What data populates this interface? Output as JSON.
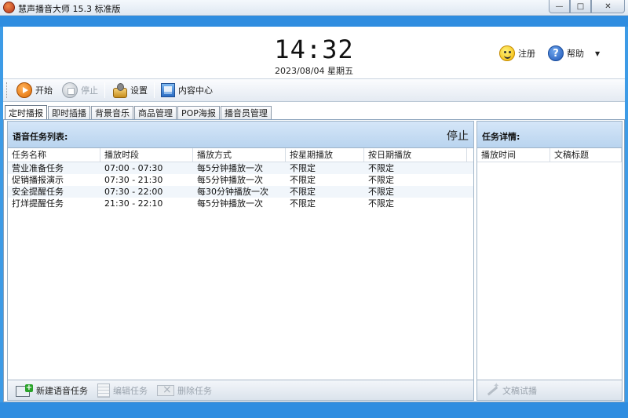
{
  "window": {
    "title": "慧声播音大师 15.3 标准版",
    "buttons": {
      "minimize": "—",
      "maximize": "□",
      "close": "✕"
    }
  },
  "header": {
    "time": "14:32",
    "date": "2023/08/04 星期五",
    "register_label": "注册",
    "help_label": "帮助",
    "dropdown": "▼"
  },
  "toolbar": {
    "start_label": "开始",
    "stop_label": "停止",
    "settings_label": "设置",
    "content_label": "内容中心"
  },
  "tabs": [
    {
      "label": "定时播报",
      "active": true
    },
    {
      "label": "即时插播"
    },
    {
      "label": "背景音乐"
    },
    {
      "label": "商品管理"
    },
    {
      "label": "POP海报"
    },
    {
      "label": "播音员管理"
    }
  ],
  "task_panel": {
    "title": "语音任务列表:",
    "status": "停止",
    "columns": [
      "任务名称",
      "播放时段",
      "播放方式",
      "按星期播放",
      "按日期播放"
    ],
    "rows": [
      [
        "营业准备任务",
        "07:00 - 07:30",
        "每5分钟播放一次",
        "不限定",
        "不限定"
      ],
      [
        "促销播报演示",
        "07:30 - 21:30",
        "每5分钟播放一次",
        "不限定",
        "不限定"
      ],
      [
        "安全提醒任务",
        "07:30 - 22:00",
        "每30分钟播放一次",
        "不限定",
        "不限定"
      ],
      [
        "打烊提醒任务",
        "21:30 - 22:10",
        "每5分钟播放一次",
        "不限定",
        "不限定"
      ]
    ],
    "footer": {
      "new_label": "新建语音任务",
      "edit_label": "编辑任务",
      "delete_label": "删除任务"
    }
  },
  "detail_panel": {
    "title": "任务详情:",
    "columns": [
      "播放时间",
      "文稿标题"
    ],
    "footer": {
      "preview_label": "文稿试播"
    }
  }
}
